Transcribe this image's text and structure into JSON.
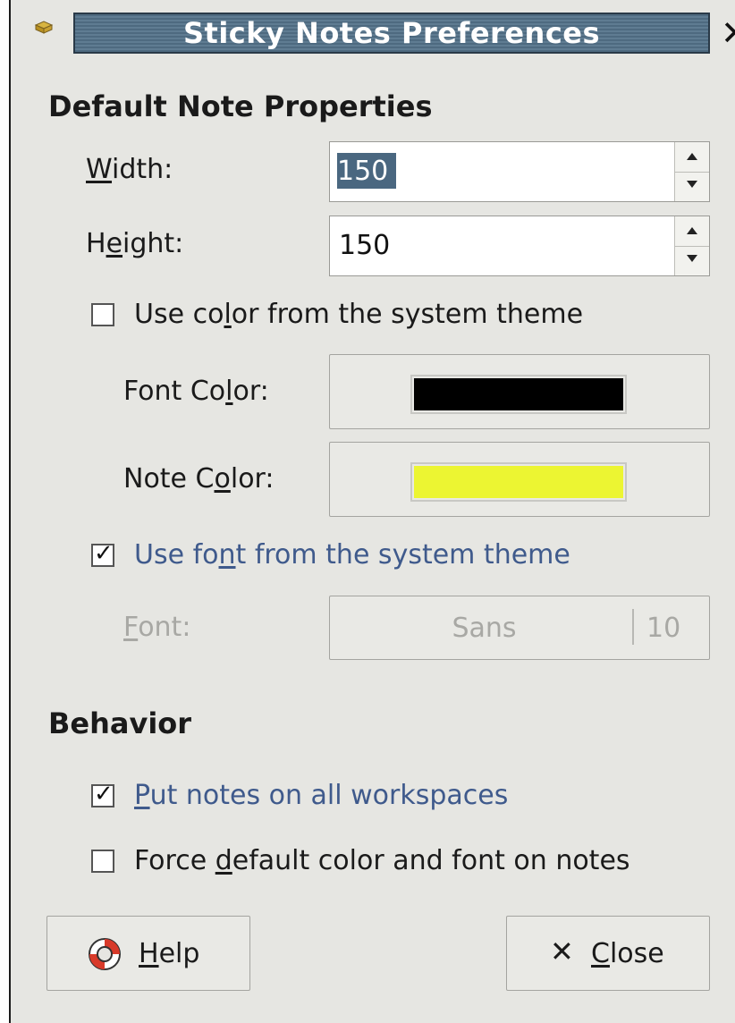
{
  "window": {
    "title": "Sticky Notes Preferences",
    "close_glyph": "✕"
  },
  "sections": {
    "default_props": "Default Note Properties",
    "behavior": "Behavior"
  },
  "width": {
    "label_pre": "",
    "label_ul": "W",
    "label_post": "idth:",
    "value": "150"
  },
  "height": {
    "label_pre": "H",
    "label_ul": "e",
    "label_post": "ight:",
    "value": "150"
  },
  "use_color": {
    "label_pre": "Use co",
    "label_ul": "l",
    "label_post": "or from the system theme",
    "checked": false
  },
  "font_color": {
    "label_pre": "Font Co",
    "label_ul": "l",
    "label_post": "or:",
    "color": "#000000"
  },
  "note_color": {
    "label_pre": "Note C",
    "label_ul": "o",
    "label_post": "lor:",
    "color": "#ecf532"
  },
  "use_font": {
    "label_pre": "Use fo",
    "label_ul": "n",
    "label_post": "t from the system theme",
    "checked": true
  },
  "font": {
    "label_pre": "",
    "label_ul": "F",
    "label_post": "ont:",
    "name": "Sans",
    "size": "10"
  },
  "all_workspaces": {
    "label_pre": "",
    "label_ul": "P",
    "label_post": "ut notes on all workspaces",
    "checked": true
  },
  "force_default": {
    "label_pre": "Force ",
    "label_ul": "d",
    "label_post": "efault color and font on notes",
    "checked": false
  },
  "buttons": {
    "help": {
      "label_pre": "",
      "label_ul": "H",
      "label_post": "elp",
      "icon": "lifebuoy-icon"
    },
    "close": {
      "label_pre": "",
      "label_ul": "C",
      "label_post": "lose",
      "icon": "close-x-icon",
      "glyph": "✕"
    }
  },
  "colors": {
    "title_bar": "#4e6a80",
    "link_text": "#3f5a8c",
    "disabled_text": "#a8a8a4",
    "selection": "#4a6780"
  }
}
